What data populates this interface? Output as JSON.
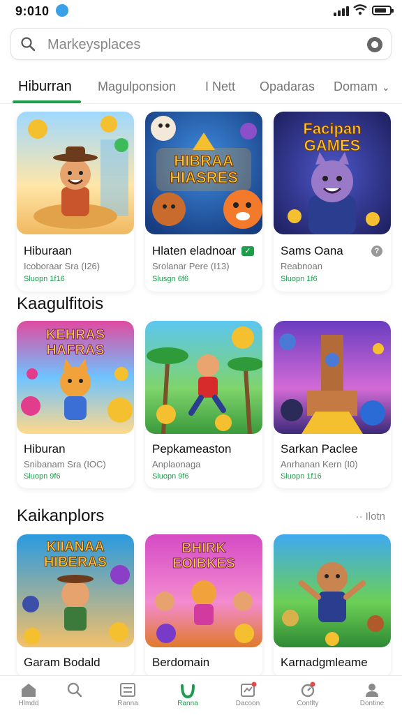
{
  "status_bar": {
    "time": "9:010"
  },
  "search": {
    "placeholder": "Markeysplaces"
  },
  "tabs": [
    {
      "label": "Hiburran",
      "active": true
    },
    {
      "label": "Magulponsion"
    },
    {
      "label": "I Nett"
    },
    {
      "label": "Opadaras"
    },
    {
      "label": "Domam"
    }
  ],
  "sections": [
    {
      "title": "",
      "cards": [
        {
          "name": "Hiburaan",
          "sub": "Icoboraar Sra (I26)",
          "price": "Sluopn 1f16",
          "badge": ""
        },
        {
          "name": "Hlaten eladnoar",
          "sub": "Srolanar Pere (I13)",
          "price": "Slusgn 6f6",
          "badge": "check"
        },
        {
          "name": "Sams Oana",
          "sub": "Reabnoan",
          "price": "Sluopn 1f6",
          "badge": "question"
        }
      ]
    },
    {
      "title": "Kaagulfitois",
      "cards": [
        {
          "name": "Hiburan",
          "sub": "Snibanam Sra (IOC)",
          "price": "Sluopn 9f6",
          "badge": ""
        },
        {
          "name": "Pepkameaston",
          "sub": "Anplaonaga",
          "price": "Sluopn 9f6",
          "badge": ""
        },
        {
          "name": "Sarkan Paclee",
          "sub": "Anrhanan Kern (I0)",
          "price": "Sluopn 1f16",
          "badge": ""
        }
      ]
    },
    {
      "title": "Kaikanplors",
      "more": "·· Ilotn",
      "cards": [
        {
          "name": "Garam Bodald",
          "sub": "",
          "price": "",
          "badge": ""
        },
        {
          "name": "Berdomain",
          "sub": "",
          "price": "",
          "badge": ""
        },
        {
          "name": "Karnadgmleame",
          "sub": "",
          "price": "",
          "badge": ""
        }
      ]
    }
  ],
  "thumb_texts": {
    "card_0_1": [
      "HIBRAA",
      "HIASRES"
    ],
    "card_0_2": [
      "Facipan",
      "GAMES"
    ],
    "card_1_0": [
      "KEHRAS",
      "HAFRAS"
    ],
    "card_2_0": [
      "KIIANAA",
      "HIBERAS"
    ],
    "card_2_1": [
      "BHIRK",
      "EOIBKES"
    ]
  },
  "bottom_nav": [
    {
      "label": "Hlmdd",
      "icon": "home-icon"
    },
    {
      "label": "",
      "icon": "search-icon"
    },
    {
      "label": "Ranna",
      "icon": "list-icon"
    },
    {
      "label": "Ranna",
      "icon": "bag-icon",
      "active": true
    },
    {
      "label": "Dacoon",
      "icon": "cart-icon"
    },
    {
      "label": "Contlty",
      "icon": "bell-icon"
    },
    {
      "label": "Dontine",
      "icon": "person-icon"
    }
  ],
  "colors": {
    "accent": "#1f9c4c"
  }
}
